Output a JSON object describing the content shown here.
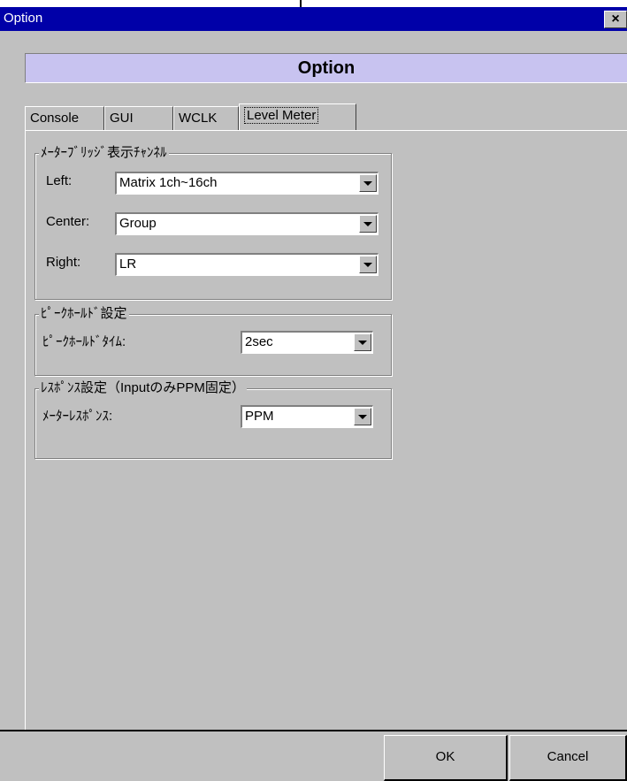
{
  "window": {
    "title": "Option",
    "close_symbol": "×"
  },
  "header": {
    "title": "Option"
  },
  "tabs": [
    {
      "label": "Console"
    },
    {
      "label": "GUI"
    },
    {
      "label": "WCLK"
    },
    {
      "label": "Level Meter",
      "active": true
    }
  ],
  "meter_bridge": {
    "legend": "ﾒｰﾀｰﾌﾞﾘｯｼﾞ表示ﾁｬﾝﾈﾙ",
    "left_label": "Left:",
    "left_value": "Matrix 1ch~16ch",
    "center_label": "Center:",
    "center_value": "Group",
    "right_label": "Right:",
    "right_value": "LR"
  },
  "peak_hold": {
    "legend": "ﾋﾟｰｸﾎｰﾙﾄﾞ設定",
    "time_label": "ﾋﾟｰｸﾎｰﾙﾄﾞﾀｲﾑ:",
    "time_value": "2sec"
  },
  "response": {
    "legend": "ﾚｽﾎﾟﾝｽ設定（InputのみPPM固定）",
    "meter_label": "ﾒｰﾀｰﾚｽﾎﾟﾝｽ:",
    "meter_value": "PPM"
  },
  "buttons": {
    "ok": "OK",
    "cancel": "Cancel"
  }
}
